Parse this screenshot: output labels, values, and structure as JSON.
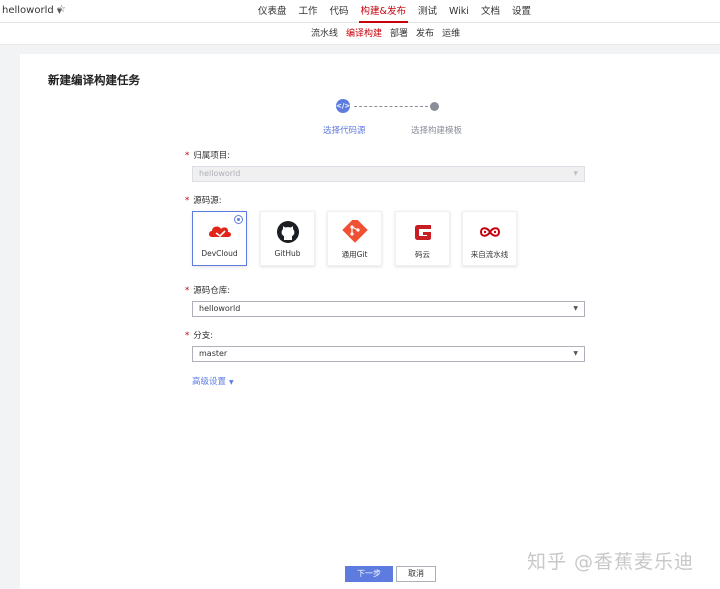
{
  "header": {
    "project_name": "helloworld",
    "nav": [
      {
        "label": "仪表盘"
      },
      {
        "label": "工作"
      },
      {
        "label": "代码"
      },
      {
        "label": "构建&发布",
        "active": true
      },
      {
        "label": "测试"
      },
      {
        "label": "Wiki"
      },
      {
        "label": "文档"
      },
      {
        "label": "设置"
      }
    ]
  },
  "subnav": [
    {
      "label": "流水线"
    },
    {
      "label": "编译构建",
      "active": true
    },
    {
      "label": "部署"
    },
    {
      "label": "发布"
    },
    {
      "label": "运维"
    }
  ],
  "page": {
    "title": "新建编译构建任务"
  },
  "steps": {
    "current_icon": "</>",
    "step1_label": "选择代码源",
    "step2_label": "选择构建模板"
  },
  "form": {
    "project_label": "归属项目:",
    "project_value": "helloworld",
    "source_label": "源码源:",
    "sources": [
      {
        "label": "DevCloud",
        "icon": "devcloud-icon",
        "selected": true
      },
      {
        "label": "GitHub",
        "icon": "github-icon"
      },
      {
        "label": "通用Git",
        "icon": "git-icon"
      },
      {
        "label": "码云",
        "icon": "gitee-icon"
      },
      {
        "label": "来自流水线",
        "icon": "pipeline-icon"
      }
    ],
    "repo_label": "源码仓库:",
    "repo_value": "helloworld",
    "branch_label": "分支:",
    "branch_value": "master",
    "advanced_label": "高级设置"
  },
  "actions": {
    "next_label": "下一步",
    "cancel_label": "取消"
  },
  "watermark": "知乎 @香蕉麦乐迪",
  "colors": {
    "accent": "#5e7ce0",
    "active_nav": "#c7000b",
    "devcloud_red": "#e1251b",
    "gitee_red": "#c71d23",
    "git_orange": "#f05033"
  }
}
